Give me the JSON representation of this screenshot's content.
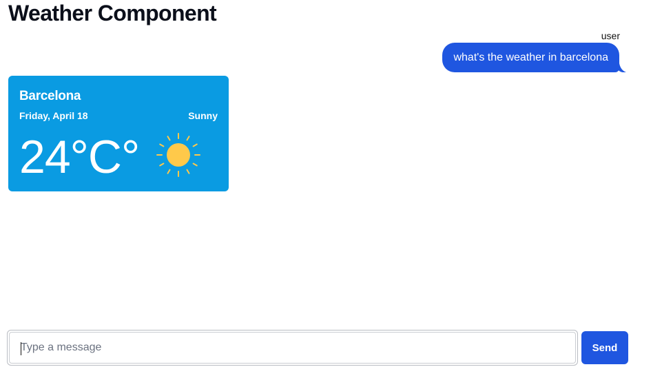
{
  "page": {
    "title": "Weather Component"
  },
  "chat": {
    "messages": [
      {
        "author": "user",
        "text": "what's the weather in barcelona"
      }
    ]
  },
  "weather": {
    "city": "Barcelona",
    "date": "Friday, April 18",
    "condition": "Sunny",
    "temperature": "24°C°",
    "icon": "sun-icon",
    "card_color": "#0a9be2",
    "sun_color": "#ffc94a"
  },
  "composer": {
    "placeholder": "Type a message",
    "value": "",
    "send_label": "Send",
    "accent_color": "#1f56e0"
  }
}
